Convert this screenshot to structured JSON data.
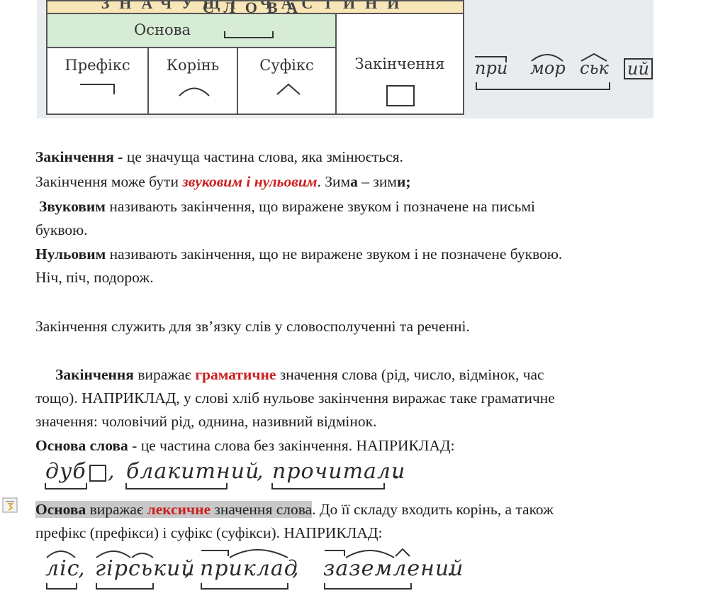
{
  "table": {
    "title": "ЗНАЧУЩІ ЧАСТИНИ СЛОВА",
    "osnova": "Основа",
    "prefix": "Префікс",
    "root": "Корінь",
    "suffix": "Суфікс",
    "ending": "Закінчення"
  },
  "example_word": {
    "prefix": "при",
    "root": "мор",
    "suffix": "ськ",
    "ending": "ий"
  },
  "text": {
    "p1_bold": "Закінчення -",
    "p1_rest": " це значуща частина слова, яка змінюється.",
    "p2_start": "Закінчення може бути ",
    "p2_red": "звуковим і нульовим",
    "p2_mid": ". Зим",
    "p2_a": "а",
    "p2_mid2": " – зим",
    "p2_y": "и;",
    "p3_bold": "Звуковим",
    "p3_rest": " називають закінчення, що виражене звуком і позначене на письмі",
    "p3_line2": "буквою.",
    "p4_bold": "Нульовим",
    "p4_rest": " називають закінчення, що не виражене звуком і не позначене буквою.",
    "p4_line2": "Ніч, піч, подорож.",
    "p5": "Закінчення служить для зв’язку слів у словосполученні та реченні.",
    "p6_bold": "Закінчення",
    "p6_mid": " виражає ",
    "p6_red": "граматичне",
    "p6_rest": " значення слова (рід, число, відмінок, час",
    "p6_line2": "тощо). НАПРИКЛАД, у слові хліб   нульове закінчення виражає таке граматичне",
    "p6_line3": "значення: чоловічий рід, однина, називний відмінок.",
    "p7_bold": "Основа слова",
    "p7_rest": " - це  частина слова без закінчення. НАПРИКЛАД:",
    "p8_bold": "Основа",
    "p8_mid": " виражає ",
    "p8_red": "лексичне",
    "p8_rest": " значення слова",
    "p8_after": ". До її складу входить корінь, а також",
    "p8_line2": "префікс (префікси) і суфікс (суфікси). НАПРИКЛАД:"
  },
  "examples1": [
    "дуб",
    ", ",
    "блакитний",
    ", ",
    "прочитали",
    "."
  ],
  "examples2": [
    "ліс",
    ",",
    "гірський",
    ",",
    "приклад",
    ",",
    "заземлений",
    "."
  ]
}
